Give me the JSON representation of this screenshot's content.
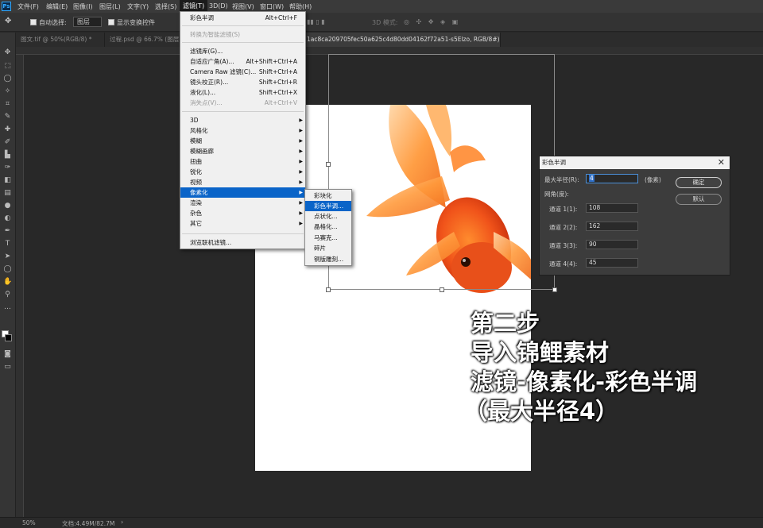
{
  "app": {
    "logo": "Ps"
  },
  "menubar": {
    "items": [
      "文件(F)",
      "编辑(E)",
      "图像(I)",
      "图层(L)",
      "文字(Y)",
      "选择(S)",
      "滤镜(T)",
      "3D(D)",
      "视图(V)",
      "窗口(W)",
      "帮助(H)"
    ],
    "active": "滤镜(T)"
  },
  "optionsbar": {
    "auto_select_label": "自动选择:",
    "auto_select_value": "图层",
    "show_transform_label": "显示变换控件",
    "mode_3d_label": "3D 模式:"
  },
  "tabs": [
    {
      "label": "图文.tif @ 50%(RGB/8) *",
      "active": false
    },
    {
      "label": "过程.psd @ 66.7% (图层",
      "active": false
    },
    {
      "label": "1ac8ca209705fec50a625c4d80dd04162f72a51-s5Elzo, RGB/8#) *",
      "active": true
    }
  ],
  "filter_menu": {
    "items": [
      {
        "label": "彩色半调",
        "shortcut": "Alt+Ctrl+F"
      },
      {
        "label": "转换为智能滤镜(S)",
        "disabled": true
      },
      {
        "label": "滤镜库(G)..."
      },
      {
        "label": "自适应广角(A)...",
        "shortcut": "Alt+Shift+Ctrl+A"
      },
      {
        "label": "Camera Raw 滤镜(C)...",
        "shortcut": "Shift+Ctrl+A"
      },
      {
        "label": "镜头校正(R)...",
        "shortcut": "Shift+Ctrl+R"
      },
      {
        "label": "液化(L)...",
        "shortcut": "Shift+Ctrl+X"
      },
      {
        "label": "消失点(V)...",
        "shortcut": "Alt+Ctrl+V",
        "disabled": true
      },
      {
        "label": "3D"
      },
      {
        "label": "风格化"
      },
      {
        "label": "模糊"
      },
      {
        "label": "模糊画廊"
      },
      {
        "label": "扭曲"
      },
      {
        "label": "锐化"
      },
      {
        "label": "视频"
      },
      {
        "label": "像素化"
      },
      {
        "label": "渲染"
      },
      {
        "label": "杂色"
      },
      {
        "label": "其它"
      },
      {
        "label": "浏览联机滤镜..."
      }
    ]
  },
  "submenu": {
    "items": [
      "彩块化",
      "彩色半调...",
      "点状化...",
      "晶格化...",
      "马赛克...",
      "碎片",
      "铜版雕刻..."
    ],
    "highlighted": "彩色半调..."
  },
  "dialog": {
    "title": "彩色半调",
    "max_radius_label": "最大半径(R):",
    "max_radius_value": "4",
    "unit": "(像素)",
    "angle_label": "网角(度):",
    "channels": [
      {
        "label": "通道 1(1):",
        "value": "108"
      },
      {
        "label": "通道 2(2):",
        "value": "162"
      },
      {
        "label": "通道 3(3):",
        "value": "90"
      },
      {
        "label": "通道 4(4):",
        "value": "45"
      }
    ],
    "ok_label": "确定",
    "reset_label": "默认"
  },
  "caption": {
    "line1": "第二步",
    "line2": "导入锦鲤素材",
    "line3": "滤镜-像素化-彩色半调",
    "line4": "（最大半径4）"
  },
  "status": {
    "zoom": "50%",
    "doc": "文档:4.49M/82.7M"
  },
  "colors": {
    "accent": "#0a64c8",
    "fish_orange": "#f26a1b",
    "panel": "#3c3c3c"
  }
}
